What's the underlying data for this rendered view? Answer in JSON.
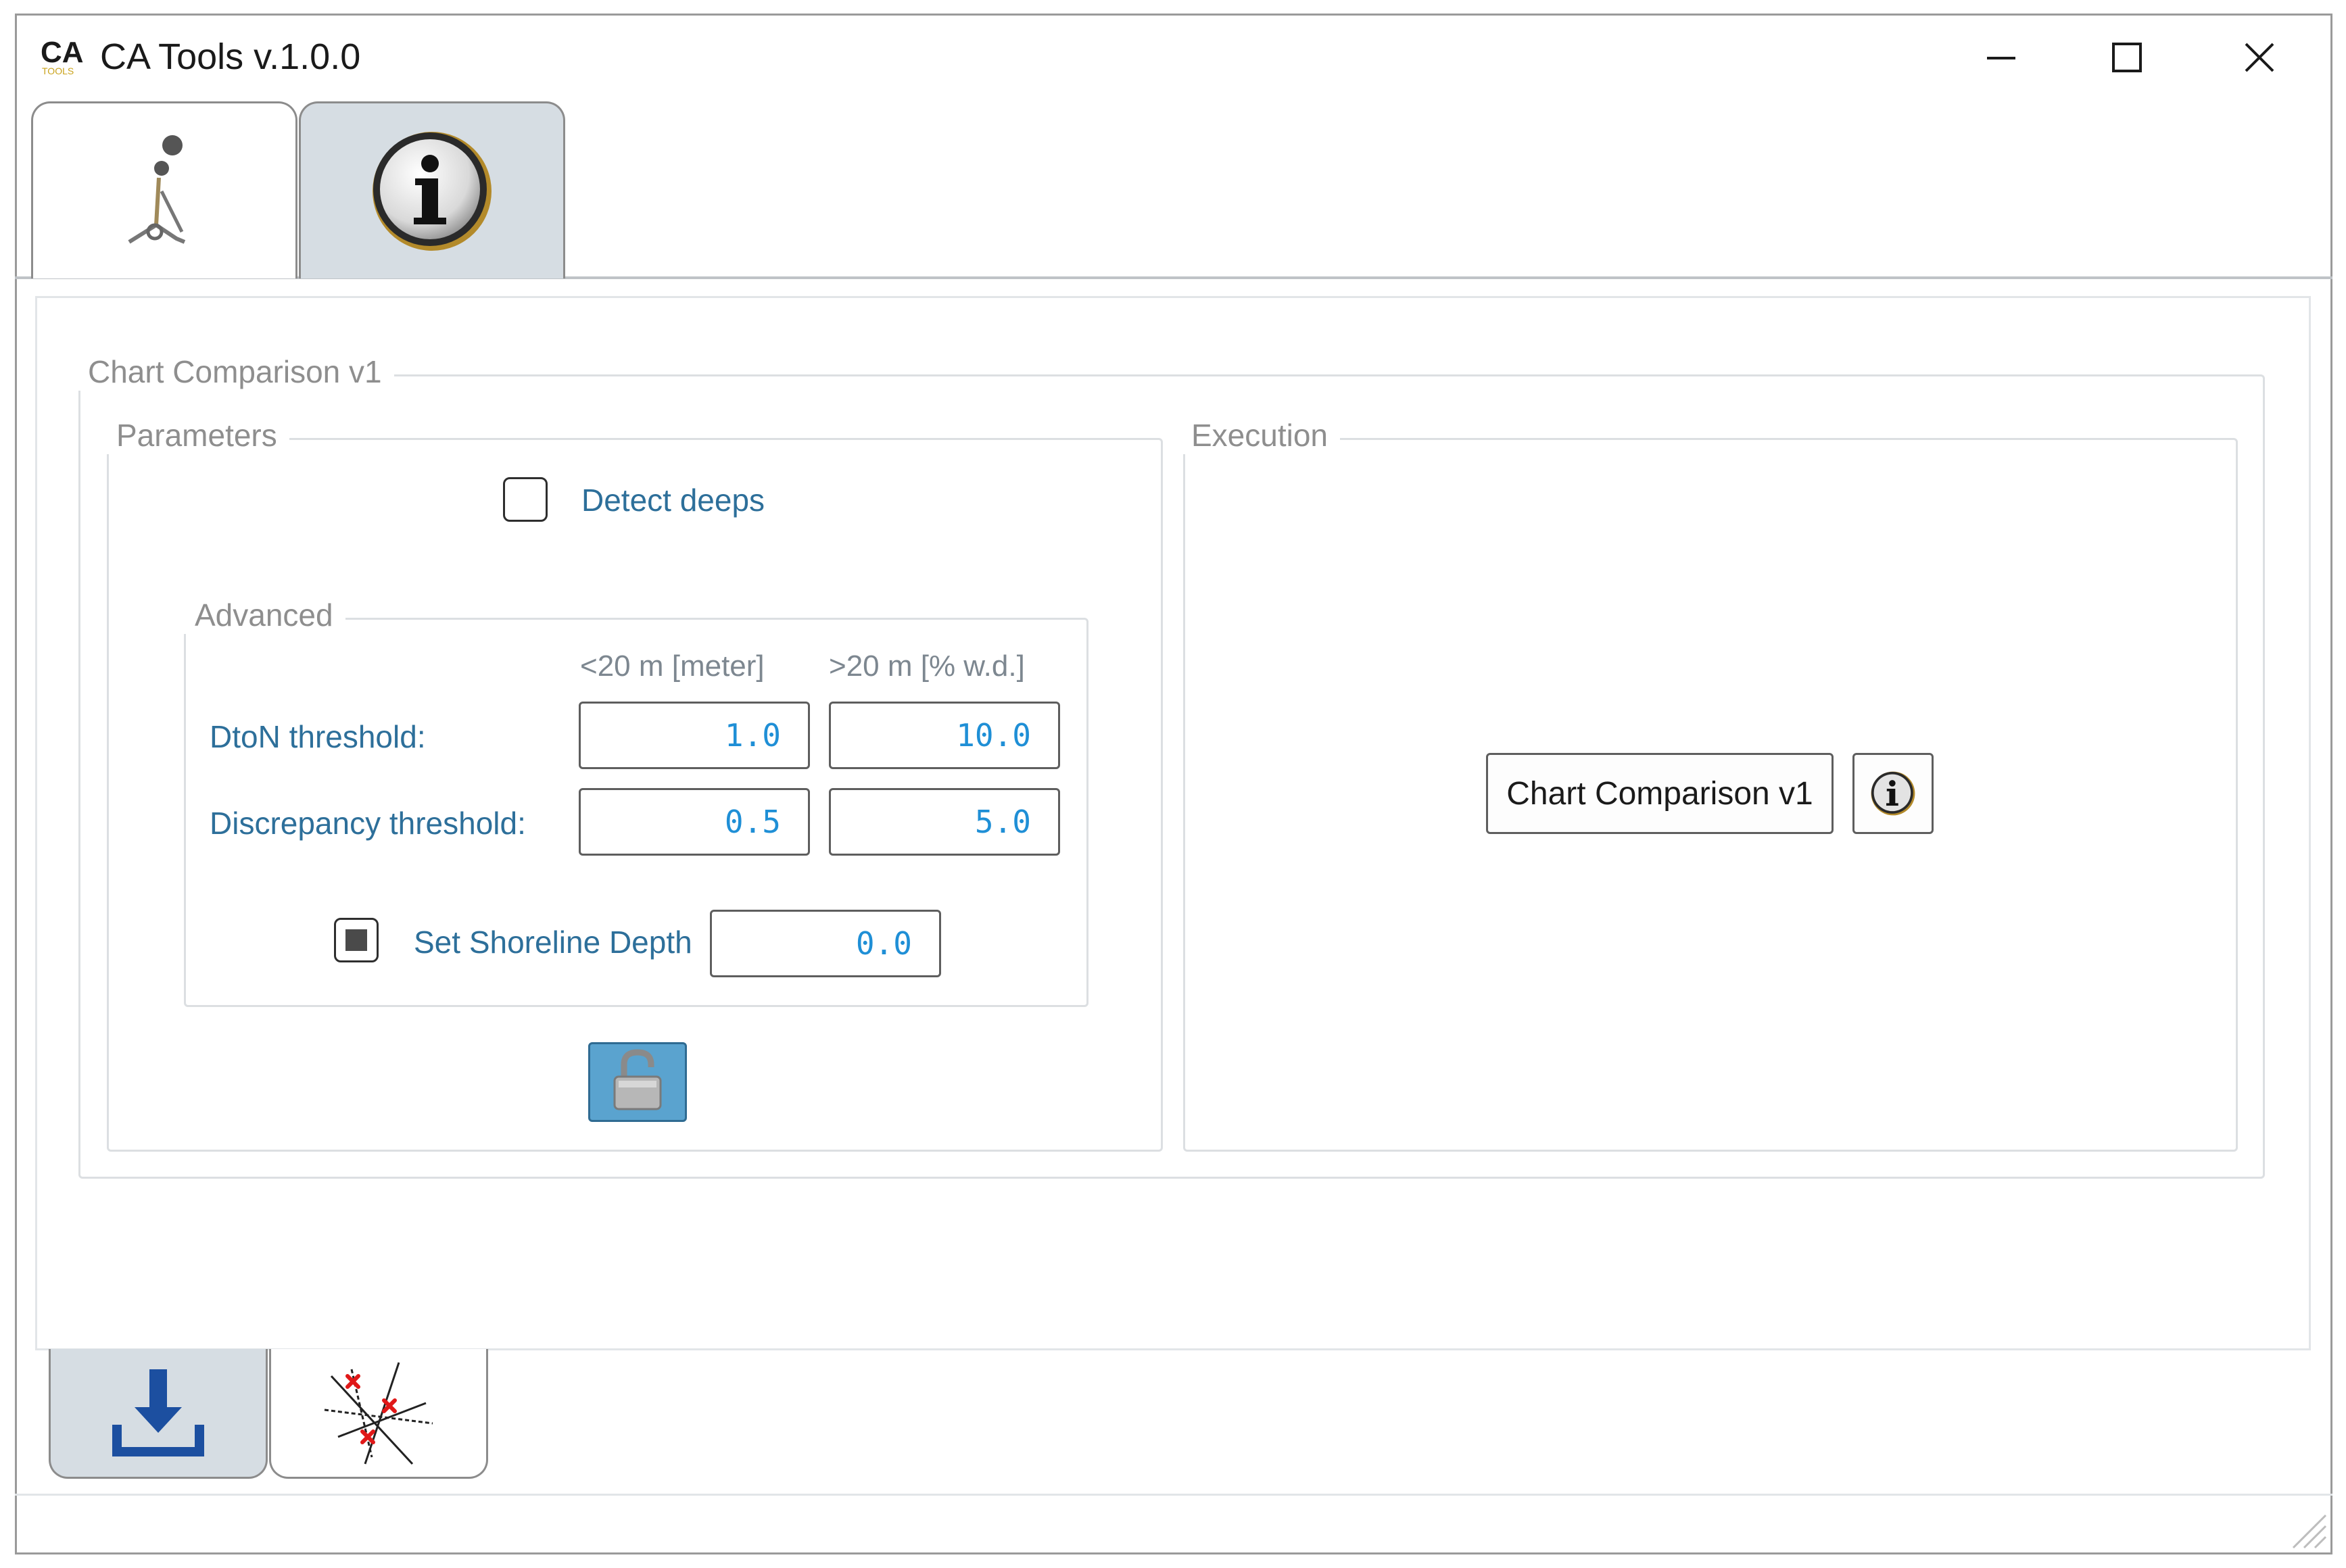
{
  "window": {
    "title": "CA Tools v.1.0.0",
    "logo_text": "CA",
    "logo_subtext": "TOOLS",
    "controls": [
      "minimize",
      "maximize",
      "close"
    ]
  },
  "top_tabs": [
    {
      "icon": "surveyor-icon",
      "active": false
    },
    {
      "icon": "info-icon",
      "active": true
    }
  ],
  "bottom_tabs": [
    {
      "icon": "download-icon",
      "active": true
    },
    {
      "icon": "chart-comparison-icon",
      "active": false
    }
  ],
  "main": {
    "section_title": "Chart Comparison v1",
    "parameters": {
      "title": "Parameters",
      "detect_deeps": {
        "label": "Detect deeps",
        "checked": false
      },
      "advanced": {
        "title": "Advanced",
        "col_less": "<20 m [meter]",
        "col_greater": ">20 m [% w.d.]",
        "rows": [
          {
            "label": "DtoN threshold:",
            "less": "1.0",
            "greater": "10.0"
          },
          {
            "label": "Discrepancy threshold:",
            "less": "0.5",
            "greater": "5.0"
          }
        ],
        "shoreline": {
          "label": "Set Shoreline Depth",
          "checked": true,
          "value": "0.0"
        }
      },
      "lock_button": {
        "icon": "unlock-icon"
      }
    },
    "execution": {
      "title": "Execution",
      "run_button_label": "Chart Comparison v1",
      "info_button": {
        "icon": "info-icon"
      }
    }
  },
  "colors": {
    "label_blue": "#2d6f9a",
    "value_blue": "#1f8fd6",
    "active_tab": "#d6dde3",
    "lock_button": "#5aa3cf",
    "download_blue": "#1c4fa0"
  }
}
